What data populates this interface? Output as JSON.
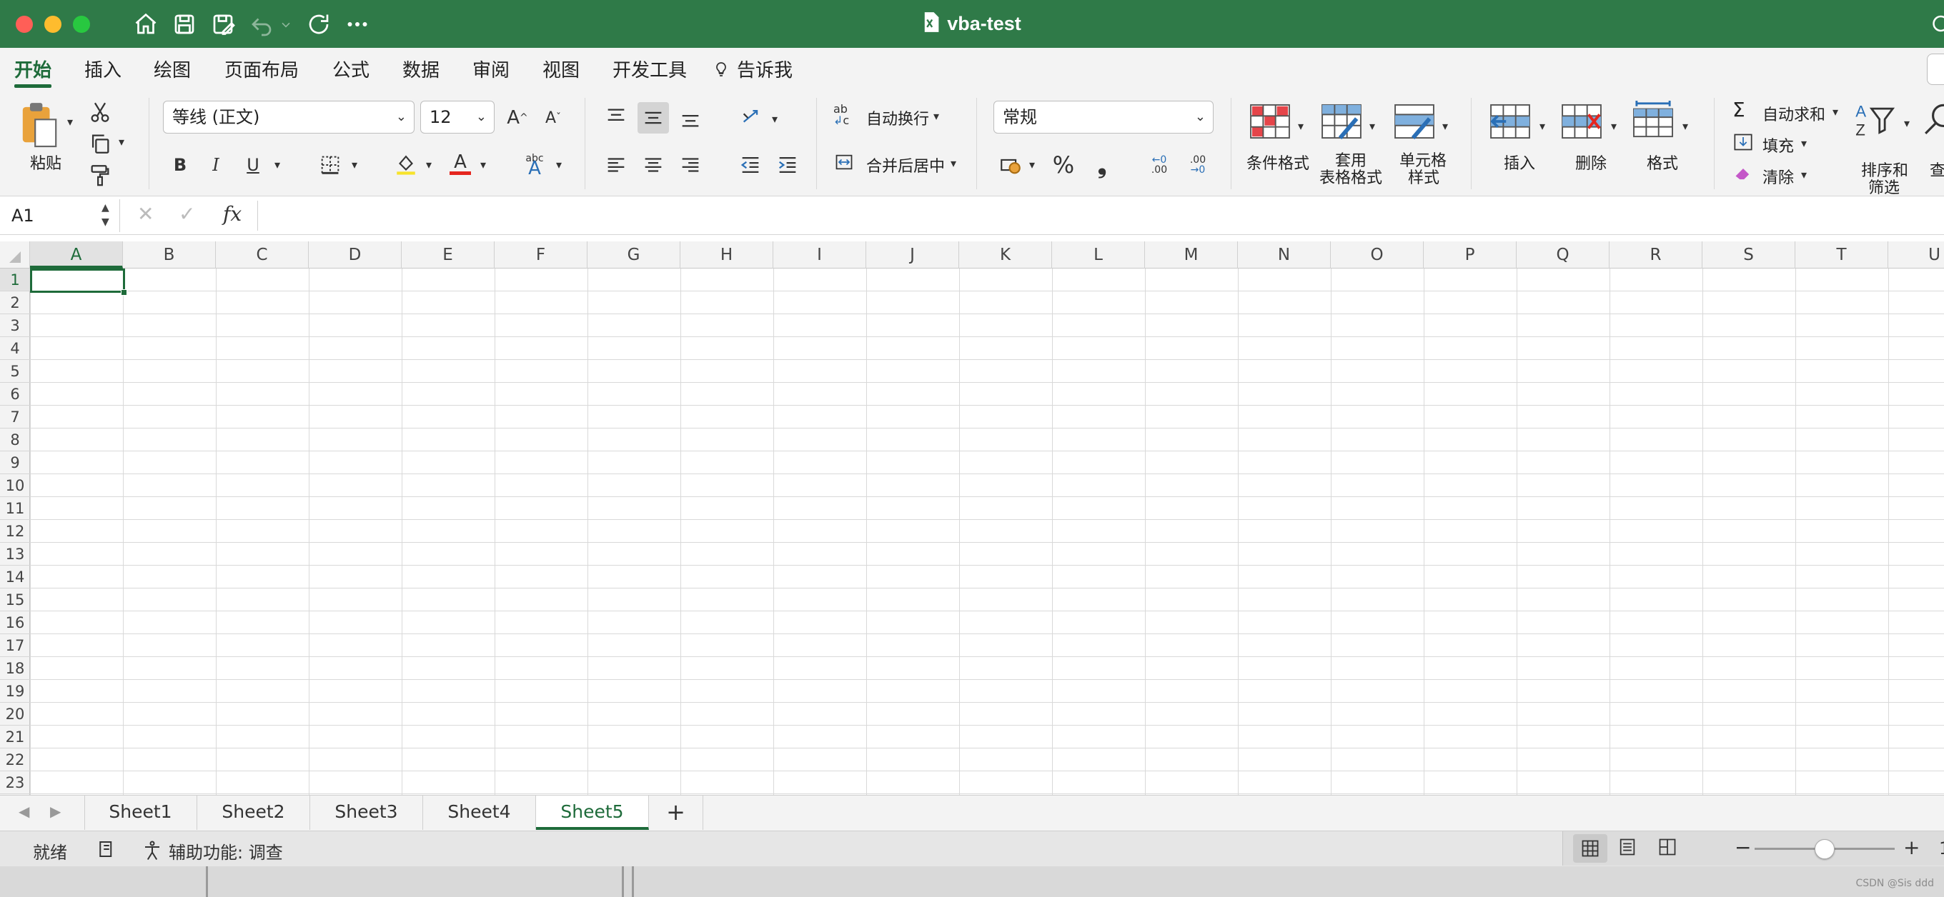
{
  "window": {
    "title": "vba-test",
    "colors": {
      "titlebar": "#2f7a48",
      "accent": "#1e6b3a",
      "close": "#ff5f57",
      "minimize": "#febc2e",
      "zoom": "#28c840"
    }
  },
  "quick_access": {
    "icons": [
      "home-icon",
      "save-icon",
      "save-as-icon",
      "undo-icon",
      "redo-icon",
      "more-icon"
    ]
  },
  "tabs": [
    "开始",
    "插入",
    "绘图",
    "页面布局",
    "公式",
    "数据",
    "审阅",
    "视图",
    "开发工具"
  ],
  "active_tab": "开始",
  "tell_me": "告诉我",
  "ribbon": {
    "clipboard": {
      "paste_label": "粘贴"
    },
    "font": {
      "name": "等线 (正文)",
      "size": "12",
      "bold": "B",
      "italic": "I",
      "underline": "U",
      "font_color_letter": "A"
    },
    "alignment": {
      "wrap_text": "自动换行",
      "merge_center": "合并后居中"
    },
    "number": {
      "format": "常规",
      "percent": "%",
      "comma": "❟"
    },
    "styles": {
      "conditional_format": "条件格式",
      "table_format_1": "套用",
      "table_format_2": "表格格式",
      "cell_styles_1": "单元格",
      "cell_styles_2": "样式"
    },
    "cells": {
      "insert": "插入",
      "delete": "删除",
      "format": "格式"
    },
    "editing": {
      "autosum": "自动求和",
      "fill": "填充",
      "clear": "清除",
      "sort_filter_1": "排序和",
      "sort_filter_2": "筛选",
      "find_1": "查"
    }
  },
  "formula_bar": {
    "name_box": "A1",
    "fx": "fx",
    "value": ""
  },
  "grid": {
    "columns": [
      "A",
      "B",
      "C",
      "D",
      "E",
      "F",
      "G",
      "H",
      "I",
      "J",
      "K",
      "L",
      "M",
      "N",
      "O",
      "P",
      "Q",
      "R",
      "S",
      "T",
      "U"
    ],
    "rows": [
      "1",
      "2",
      "3",
      "4",
      "5",
      "6",
      "7",
      "8",
      "9",
      "10",
      "11",
      "12",
      "13",
      "14",
      "15",
      "16",
      "17",
      "18",
      "19",
      "20",
      "21",
      "22",
      "23"
    ],
    "selected_cell": "A1"
  },
  "sheets": [
    "Sheet1",
    "Sheet2",
    "Sheet3",
    "Sheet4",
    "Sheet5"
  ],
  "active_sheet": "Sheet5",
  "status_bar": {
    "ready": "就绪",
    "accessibility": "辅助功能: 调查",
    "zoom_minus": "−",
    "zoom_plus": "+",
    "zoom_level_fraction": 0.5,
    "zoom_value_cut": "1"
  },
  "watermark": "CSDN @Sis ddd"
}
